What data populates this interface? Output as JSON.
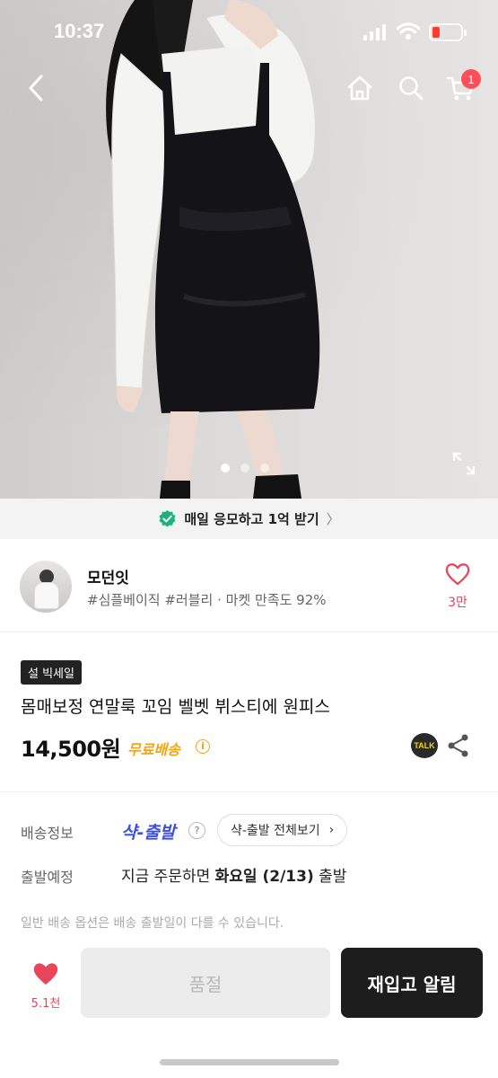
{
  "status_bar": {
    "time": "10:37"
  },
  "header": {
    "cart_count": "1"
  },
  "gallery": {
    "total_images": 3,
    "active_index": 0
  },
  "promo": {
    "text": "매일 응모하고 1억 받기"
  },
  "seller": {
    "name": "모던잇",
    "tags": "#심플베이직 #러블리 · 마켓 만족도 92%",
    "favorite_count": "3만"
  },
  "product": {
    "badge": "설 빅세일",
    "title": "몸매보정 연말룩 꼬임 벨벳 뷔스티에 원피스",
    "price": "14,500원",
    "free_shipping": "무료배송",
    "talk_label": "TALK"
  },
  "shipping": {
    "label": "배송정보",
    "service": "샥-출발",
    "view_all": "샥-출발 전체보기",
    "depart_label": "출발예정",
    "depart_prefix": "지금 주문하면 ",
    "depart_date": "화요일 (2/13)",
    "depart_suffix": " 출발",
    "note": "일반 배송 옵션은 배송 출발일이 다를 수 있습니다."
  },
  "bottom_bar": {
    "like_count": "5.1천",
    "soldout_label": "품절",
    "restock_label": "재입고 알림"
  },
  "colors": {
    "accent_pink": "#e8445a",
    "free_ship_orange": "#f2a516",
    "shak_blue": "#3d4fe0",
    "promo_green": "#1db27b"
  }
}
